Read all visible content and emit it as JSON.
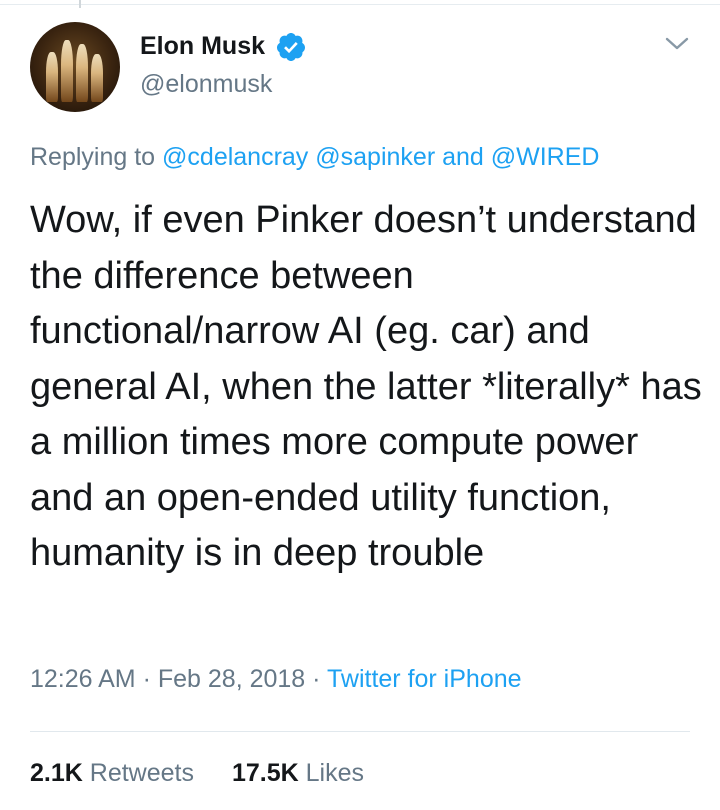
{
  "tweet": {
    "author": {
      "name": "Elon Musk",
      "handle": "@elonmusk",
      "verified": true
    },
    "reply": {
      "prefix": "Replying to",
      "mention1": "@cdelancray",
      "mention2": "@sapinker",
      "conjunction": "and",
      "mention3": "@WIRED"
    },
    "text": "Wow, if even Pinker doesn’t understand the difference between functional/narrow AI (eg. car) and general AI, when the latter *literally* has a million times more compute power and an open-ended utility function, humanity is in deep trouble",
    "time": "12:26 AM",
    "sep": "·",
    "date": "Feb 28, 2018",
    "source": "Twitter for iPhone",
    "stats": {
      "retweets_count": "2.1K",
      "retweets_label": "Retweets",
      "likes_count": "17.5K",
      "likes_label": "Likes"
    }
  },
  "colors": {
    "accent": "#1da1f2",
    "muted": "#657786",
    "text": "#14171a",
    "divider": "#e1e8ed"
  },
  "icons": {
    "verified": "verified-badge-icon",
    "menu": "chevron-down-icon"
  }
}
